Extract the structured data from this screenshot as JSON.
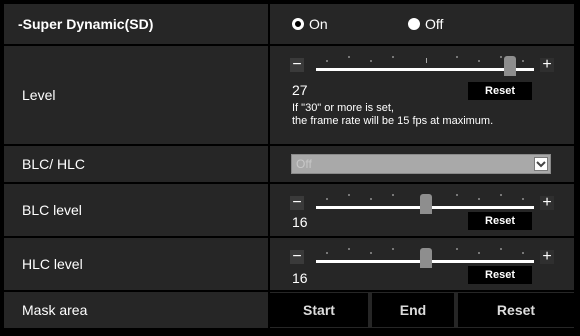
{
  "sd": {
    "label": "-Super Dynamic(SD)",
    "options": [
      "On",
      "Off"
    ],
    "selected": "On"
  },
  "level": {
    "label": "Level",
    "value": "27",
    "reset": "Reset",
    "note_line1": "If \"30\" or more is set,",
    "note_line2": "the frame rate will be 15 fps at maximum.",
    "minus": "−",
    "plus": "+"
  },
  "blc_hlc": {
    "label": "BLC/ HLC",
    "selected": "Off"
  },
  "blc_level": {
    "label": "BLC level",
    "value": "16",
    "reset": "Reset",
    "minus": "−",
    "plus": "+"
  },
  "hlc_level": {
    "label": "HLC level",
    "value": "16",
    "reset": "Reset",
    "minus": "−",
    "plus": "+"
  },
  "mask_area": {
    "label": "Mask area",
    "start": "Start",
    "end": "End",
    "reset": "Reset"
  }
}
